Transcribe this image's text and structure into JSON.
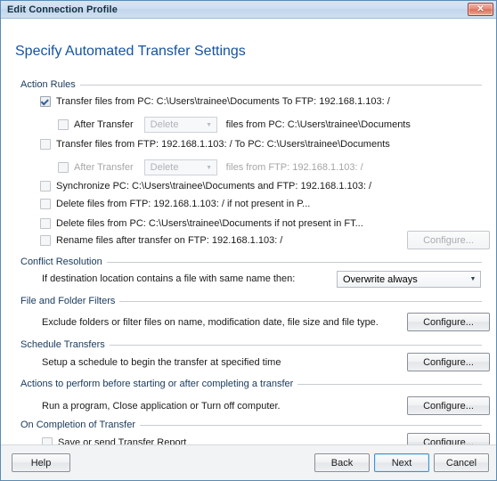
{
  "window": {
    "title": "Edit Connection Profile",
    "close_label": "✕"
  },
  "page_title": "Specify Automated Transfer Settings",
  "groups": {
    "action_rules": "Action Rules",
    "conflict_resolution": "Conflict Resolution",
    "file_folder_filters": "File and Folder Filters",
    "schedule_transfers": "Schedule Transfers",
    "actions_before_after": "Actions to perform before starting or after completing a transfer",
    "on_completion": "On Completion of Transfer"
  },
  "action_rules": {
    "rule1": {
      "label": "Transfer files from PC: C:\\Users\\trainee\\Documents  To  FTP: 192.168.1.103: /",
      "checked": true
    },
    "rule1_after": {
      "label": "After Transfer",
      "checked": false,
      "select_value": "Delete",
      "suffix": "files from PC: C:\\Users\\trainee\\Documents"
    },
    "rule2": {
      "label": "Transfer files from FTP: 192.168.1.103: /  To  PC: C:\\Users\\trainee\\Documents",
      "checked": false
    },
    "rule2_after": {
      "label": "After Transfer",
      "checked": false,
      "select_value": "Delete",
      "suffix": "files from FTP: 192.168.1.103: /"
    },
    "rule3": {
      "label": "Synchronize PC: C:\\Users\\trainee\\Documents and FTP: 192.168.1.103: /",
      "checked": false
    },
    "rule4": {
      "label": "Delete files from FTP: 192.168.1.103: / if not present in P...",
      "checked": false
    },
    "rule5": {
      "label": "Delete files from PC: C:\\Users\\trainee\\Documents if not present in FT...",
      "checked": false
    },
    "rule6": {
      "label": "Rename files after transfer on FTP: 192.168.1.103: /",
      "checked": false,
      "configure_label": "Configure...",
      "configure_enabled": false
    }
  },
  "conflict_resolution": {
    "prompt": "If destination location contains a file with same name then:",
    "value": "Overwrite always"
  },
  "file_folder_filters": {
    "description": "Exclude folders or filter files on name, modification date, file size and file type.",
    "configure_label": "Configure..."
  },
  "schedule_transfers": {
    "description": "Setup a schedule to begin the transfer at specified time",
    "configure_label": "Configure..."
  },
  "actions_before_after": {
    "description": "Run a program, Close application or Turn off computer.",
    "configure_label": "Configure..."
  },
  "on_completion": {
    "checkbox_label": "Save or send Transfer Report",
    "checked": false,
    "configure_label": "Configure..."
  },
  "footer": {
    "help": "Help",
    "back": "Back",
    "next": "Next",
    "cancel": "Cancel"
  },
  "colors": {
    "title_text": "#16529e",
    "group_label": "#17395c",
    "titlebar_start": "#d7e4f2",
    "close_button": "#d8705a",
    "default_button_border": "#3c93d4"
  }
}
